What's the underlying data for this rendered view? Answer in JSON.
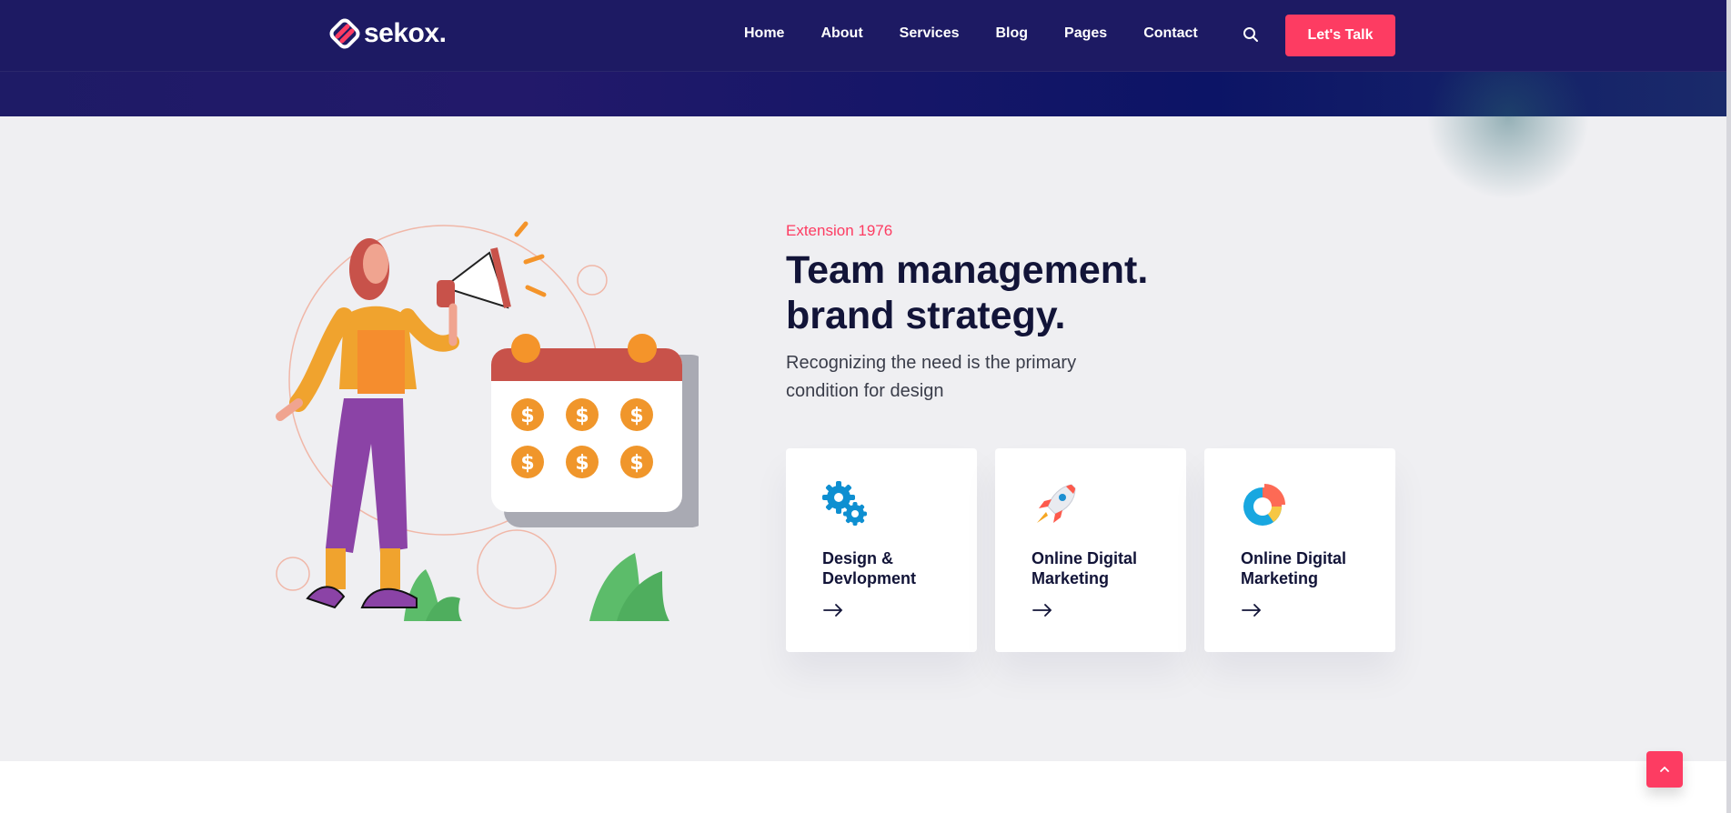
{
  "brand": {
    "name": "sekox",
    "dot": ".",
    "accent": "#fd3c62",
    "header_bg": "#1d1a63"
  },
  "nav": {
    "items": [
      "Home",
      "About",
      "Services",
      "Blog",
      "Pages",
      "Contact"
    ]
  },
  "header": {
    "search_icon": "search-icon",
    "cta_label": "Let's Talk"
  },
  "hero": {
    "eyebrow": "Extension 1976",
    "title_line1": "Team management.",
    "title_line2": "brand strategy.",
    "lead": "Recognizing the need is the primary condition for design"
  },
  "cards": [
    {
      "icon": "gears-icon",
      "label": "Design & Devlopment"
    },
    {
      "icon": "rocket-icon",
      "label": "Online Digital Marketing"
    },
    {
      "icon": "pie-chart-icon",
      "label": "Online Digital Marketing"
    }
  ],
  "scroll_top": {
    "icon": "chevron-up-icon"
  }
}
